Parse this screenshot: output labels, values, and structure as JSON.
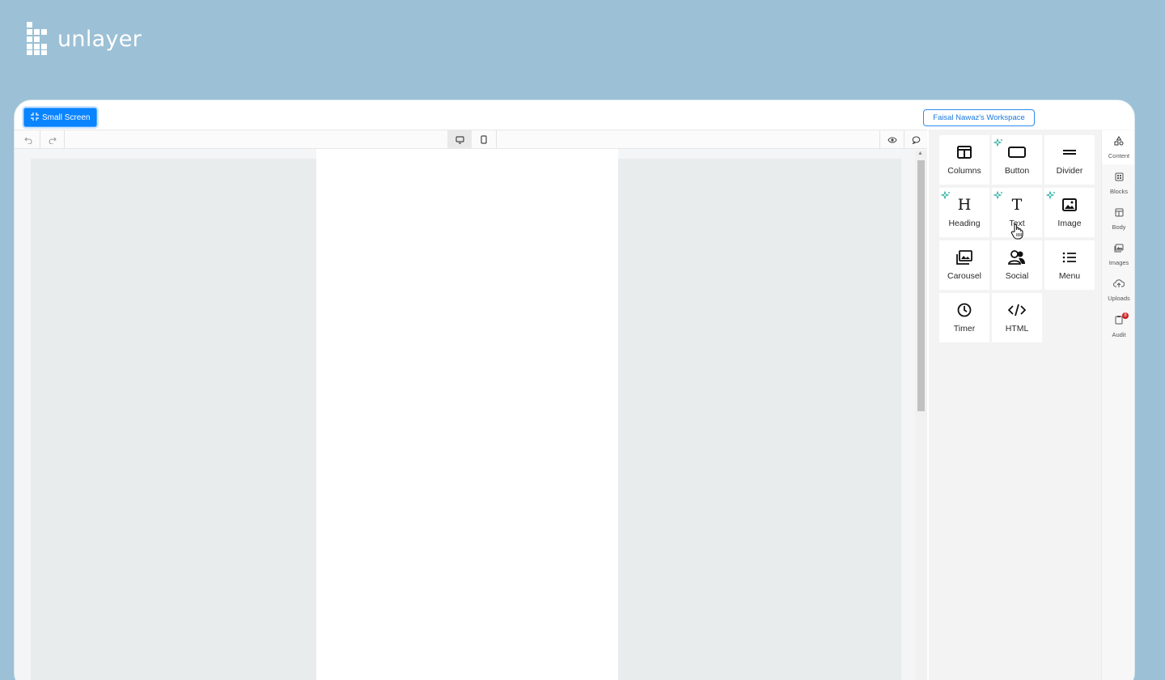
{
  "brand": {
    "name": "unlayer"
  },
  "topbar": {
    "small_screen_label": "Small Screen",
    "workspace_label": "Faisal Nawaz's Workspace"
  },
  "toolbar": {
    "undo_icon": "undo-icon",
    "redo_icon": "redo-icon",
    "desktop_icon": "desktop-icon",
    "mobile_icon": "mobile-icon",
    "preview_icon": "eye-icon",
    "comments_icon": "comment-icon",
    "active_device": "desktop"
  },
  "tools": [
    {
      "label": "Columns",
      "icon": "columns-icon",
      "ai": false
    },
    {
      "label": "Button",
      "icon": "button-icon",
      "ai": true
    },
    {
      "label": "Divider",
      "icon": "divider-icon",
      "ai": false
    },
    {
      "label": "Heading",
      "icon": "heading-icon",
      "ai": true
    },
    {
      "label": "Text",
      "icon": "text-icon",
      "ai": true
    },
    {
      "label": "Image",
      "icon": "image-icon",
      "ai": true
    },
    {
      "label": "Carousel",
      "icon": "carousel-icon",
      "ai": false
    },
    {
      "label": "Social",
      "icon": "social-icon",
      "ai": false
    },
    {
      "label": "Menu",
      "icon": "menu-icon",
      "ai": false
    },
    {
      "label": "Timer",
      "icon": "timer-icon",
      "ai": false
    },
    {
      "label": "HTML",
      "icon": "html-icon",
      "ai": false
    }
  ],
  "rail": [
    {
      "label": "Content",
      "icon": "content-icon",
      "active": true
    },
    {
      "label": "Blocks",
      "icon": "blocks-icon",
      "active": false
    },
    {
      "label": "Body",
      "icon": "body-icon",
      "active": false
    },
    {
      "label": "Images",
      "icon": "images-icon",
      "active": false
    },
    {
      "label": "Uploads",
      "icon": "uploads-icon",
      "active": false
    },
    {
      "label": "Audit",
      "icon": "audit-icon",
      "active": false,
      "badge": "8"
    }
  ],
  "colors": {
    "background": "#9cc0d5",
    "accent": "#0a84ff",
    "ai_spark": "#1aa99a",
    "badge": "#d32020"
  }
}
